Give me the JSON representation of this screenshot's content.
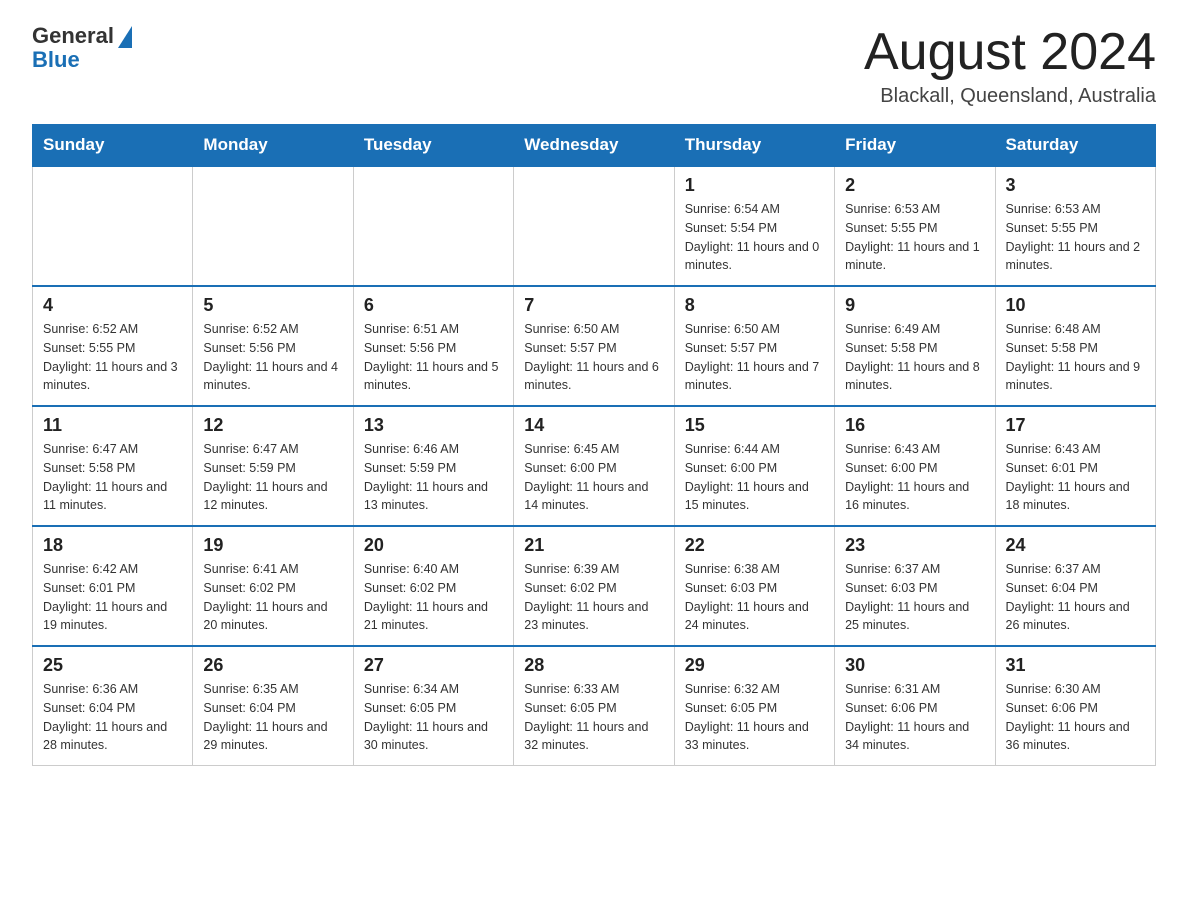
{
  "header": {
    "logo_general": "General",
    "logo_blue": "Blue",
    "month_title": "August 2024",
    "location": "Blackall, Queensland, Australia"
  },
  "weekdays": [
    "Sunday",
    "Monday",
    "Tuesday",
    "Wednesday",
    "Thursday",
    "Friday",
    "Saturday"
  ],
  "weeks": [
    [
      {
        "day": "",
        "info": ""
      },
      {
        "day": "",
        "info": ""
      },
      {
        "day": "",
        "info": ""
      },
      {
        "day": "",
        "info": ""
      },
      {
        "day": "1",
        "info": "Sunrise: 6:54 AM\nSunset: 5:54 PM\nDaylight: 11 hours and 0 minutes."
      },
      {
        "day": "2",
        "info": "Sunrise: 6:53 AM\nSunset: 5:55 PM\nDaylight: 11 hours and 1 minute."
      },
      {
        "day": "3",
        "info": "Sunrise: 6:53 AM\nSunset: 5:55 PM\nDaylight: 11 hours and 2 minutes."
      }
    ],
    [
      {
        "day": "4",
        "info": "Sunrise: 6:52 AM\nSunset: 5:55 PM\nDaylight: 11 hours and 3 minutes."
      },
      {
        "day": "5",
        "info": "Sunrise: 6:52 AM\nSunset: 5:56 PM\nDaylight: 11 hours and 4 minutes."
      },
      {
        "day": "6",
        "info": "Sunrise: 6:51 AM\nSunset: 5:56 PM\nDaylight: 11 hours and 5 minutes."
      },
      {
        "day": "7",
        "info": "Sunrise: 6:50 AM\nSunset: 5:57 PM\nDaylight: 11 hours and 6 minutes."
      },
      {
        "day": "8",
        "info": "Sunrise: 6:50 AM\nSunset: 5:57 PM\nDaylight: 11 hours and 7 minutes."
      },
      {
        "day": "9",
        "info": "Sunrise: 6:49 AM\nSunset: 5:58 PM\nDaylight: 11 hours and 8 minutes."
      },
      {
        "day": "10",
        "info": "Sunrise: 6:48 AM\nSunset: 5:58 PM\nDaylight: 11 hours and 9 minutes."
      }
    ],
    [
      {
        "day": "11",
        "info": "Sunrise: 6:47 AM\nSunset: 5:58 PM\nDaylight: 11 hours and 11 minutes."
      },
      {
        "day": "12",
        "info": "Sunrise: 6:47 AM\nSunset: 5:59 PM\nDaylight: 11 hours and 12 minutes."
      },
      {
        "day": "13",
        "info": "Sunrise: 6:46 AM\nSunset: 5:59 PM\nDaylight: 11 hours and 13 minutes."
      },
      {
        "day": "14",
        "info": "Sunrise: 6:45 AM\nSunset: 6:00 PM\nDaylight: 11 hours and 14 minutes."
      },
      {
        "day": "15",
        "info": "Sunrise: 6:44 AM\nSunset: 6:00 PM\nDaylight: 11 hours and 15 minutes."
      },
      {
        "day": "16",
        "info": "Sunrise: 6:43 AM\nSunset: 6:00 PM\nDaylight: 11 hours and 16 minutes."
      },
      {
        "day": "17",
        "info": "Sunrise: 6:43 AM\nSunset: 6:01 PM\nDaylight: 11 hours and 18 minutes."
      }
    ],
    [
      {
        "day": "18",
        "info": "Sunrise: 6:42 AM\nSunset: 6:01 PM\nDaylight: 11 hours and 19 minutes."
      },
      {
        "day": "19",
        "info": "Sunrise: 6:41 AM\nSunset: 6:02 PM\nDaylight: 11 hours and 20 minutes."
      },
      {
        "day": "20",
        "info": "Sunrise: 6:40 AM\nSunset: 6:02 PM\nDaylight: 11 hours and 21 minutes."
      },
      {
        "day": "21",
        "info": "Sunrise: 6:39 AM\nSunset: 6:02 PM\nDaylight: 11 hours and 23 minutes."
      },
      {
        "day": "22",
        "info": "Sunrise: 6:38 AM\nSunset: 6:03 PM\nDaylight: 11 hours and 24 minutes."
      },
      {
        "day": "23",
        "info": "Sunrise: 6:37 AM\nSunset: 6:03 PM\nDaylight: 11 hours and 25 minutes."
      },
      {
        "day": "24",
        "info": "Sunrise: 6:37 AM\nSunset: 6:04 PM\nDaylight: 11 hours and 26 minutes."
      }
    ],
    [
      {
        "day": "25",
        "info": "Sunrise: 6:36 AM\nSunset: 6:04 PM\nDaylight: 11 hours and 28 minutes."
      },
      {
        "day": "26",
        "info": "Sunrise: 6:35 AM\nSunset: 6:04 PM\nDaylight: 11 hours and 29 minutes."
      },
      {
        "day": "27",
        "info": "Sunrise: 6:34 AM\nSunset: 6:05 PM\nDaylight: 11 hours and 30 minutes."
      },
      {
        "day": "28",
        "info": "Sunrise: 6:33 AM\nSunset: 6:05 PM\nDaylight: 11 hours and 32 minutes."
      },
      {
        "day": "29",
        "info": "Sunrise: 6:32 AM\nSunset: 6:05 PM\nDaylight: 11 hours and 33 minutes."
      },
      {
        "day": "30",
        "info": "Sunrise: 6:31 AM\nSunset: 6:06 PM\nDaylight: 11 hours and 34 minutes."
      },
      {
        "day": "31",
        "info": "Sunrise: 6:30 AM\nSunset: 6:06 PM\nDaylight: 11 hours and 36 minutes."
      }
    ]
  ]
}
